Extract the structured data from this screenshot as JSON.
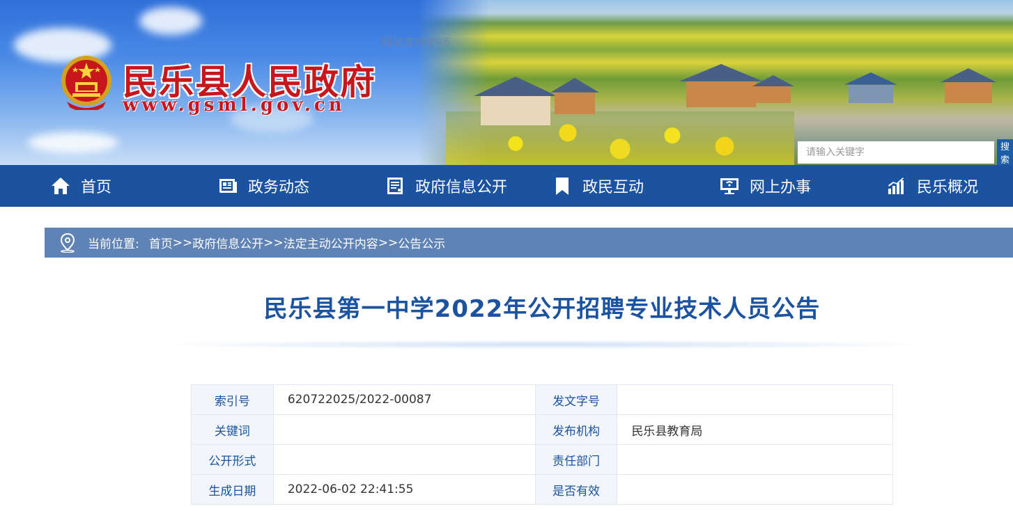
{
  "header": {
    "site_title": "民乐县人民政府",
    "site_url": "www.gsml.gov.cn",
    "ipv6_note": "网站支持IPV6",
    "search_placeholder": "请输入关键字",
    "search_button_label": "搜索",
    "emblem_icon": "national-emblem-icon"
  },
  "nav": {
    "items": [
      {
        "label": "首页",
        "icon": "home-icon"
      },
      {
        "label": "政务动态",
        "icon": "newspaper-icon"
      },
      {
        "label": "政府信息公开",
        "icon": "document-list-icon"
      },
      {
        "label": "政民互动",
        "icon": "bookmark-icon"
      },
      {
        "label": "网上办事",
        "icon": "monitor-icon"
      },
      {
        "label": "民乐概况",
        "icon": "bar-chart-icon"
      }
    ]
  },
  "breadcrumb": {
    "label": "当前位置:",
    "separator": ">>",
    "items": [
      "首页",
      "政府信息公开",
      "法定主动公开内容",
      "公告公示"
    ]
  },
  "article": {
    "title": "民乐县第一中学2022年公开招聘专业技术人员公告"
  },
  "meta": {
    "rows": [
      {
        "k1": "索引号",
        "v1": "620722025/2022-00087",
        "k2": "发文字号",
        "v2": ""
      },
      {
        "k1": "关键词",
        "v1": "",
        "k2": "发布机构",
        "v2": "民乐县教育局"
      },
      {
        "k1": "公开形式",
        "v1": "",
        "k2": "责任部门",
        "v2": ""
      },
      {
        "k1": "生成日期",
        "v1": "2022-06-02 22:41:55",
        "k2": "是否有效",
        "v2": ""
      }
    ]
  },
  "colors": {
    "nav_bg": "#1b53a0",
    "breadcrumb_bg": "#6083b6",
    "title_color": "#1b53a0",
    "brand_red": "#c8161d"
  }
}
